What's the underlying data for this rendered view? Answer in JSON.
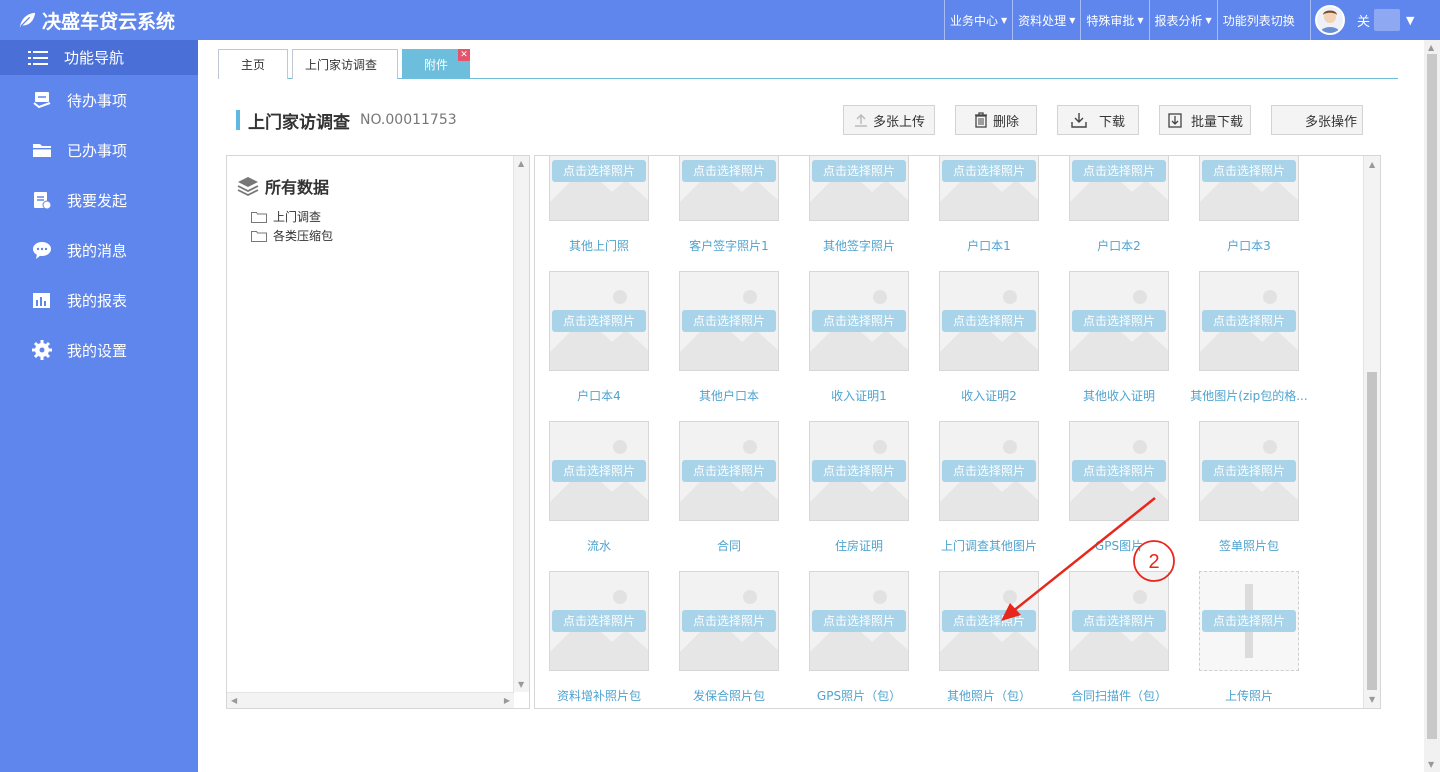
{
  "app": {
    "title": "决盛车贷云系统"
  },
  "topnav": [
    {
      "label": "业务中心",
      "caret": true
    },
    {
      "label": "资料处理",
      "caret": true
    },
    {
      "label": "特殊审批",
      "caret": true
    },
    {
      "label": "报表分析",
      "caret": true
    },
    {
      "label": "功能列表切换",
      "caret": false
    }
  ],
  "user": {
    "name": "关"
  },
  "sidebar": {
    "header": "功能导航",
    "items": [
      {
        "label": "待办事项",
        "icon": "todo-icon"
      },
      {
        "label": "已办事项",
        "icon": "folder-icon"
      },
      {
        "label": "我要发起",
        "icon": "launch-icon"
      },
      {
        "label": "我的消息",
        "icon": "message-icon"
      },
      {
        "label": "我的报表",
        "icon": "report-icon"
      },
      {
        "label": "我的设置",
        "icon": "gear-icon"
      }
    ]
  },
  "tabs": [
    {
      "label": "主页"
    },
    {
      "label": "上门家访调查"
    },
    {
      "label": "附件",
      "active": true
    }
  ],
  "page": {
    "title": "上门家访调查",
    "number": "NO.00011753"
  },
  "toolbar": {
    "upload_multi": "多张上传",
    "delete": "删除",
    "download": "下载",
    "batch_download": "批量下载",
    "multi_op": "多张操作"
  },
  "tree": {
    "root": "所有数据",
    "nodes": [
      "上门调查",
      "各类压缩包"
    ]
  },
  "gallery": {
    "select_label": "点击选择照片",
    "items": [
      "其他上门照",
      "客户签字照片1",
      "其他签字照片",
      "户口本1",
      "户口本2",
      "户口本3",
      "户口本4",
      "其他户口本",
      "收入证明1",
      "收入证明2",
      "其他收入证明",
      "其他图片(zip包的格...",
      "流水",
      "合同",
      "住房证明",
      "上门调查其他图片",
      "GPS图片",
      "签单照片包",
      "资料增补照片包",
      "发保合照片包",
      "GPS照片（包）",
      "其他照片（包）",
      "合同扫描件（包）",
      "上传照片"
    ]
  },
  "annotation": {
    "number": "2",
    "color": "#e8271c"
  }
}
